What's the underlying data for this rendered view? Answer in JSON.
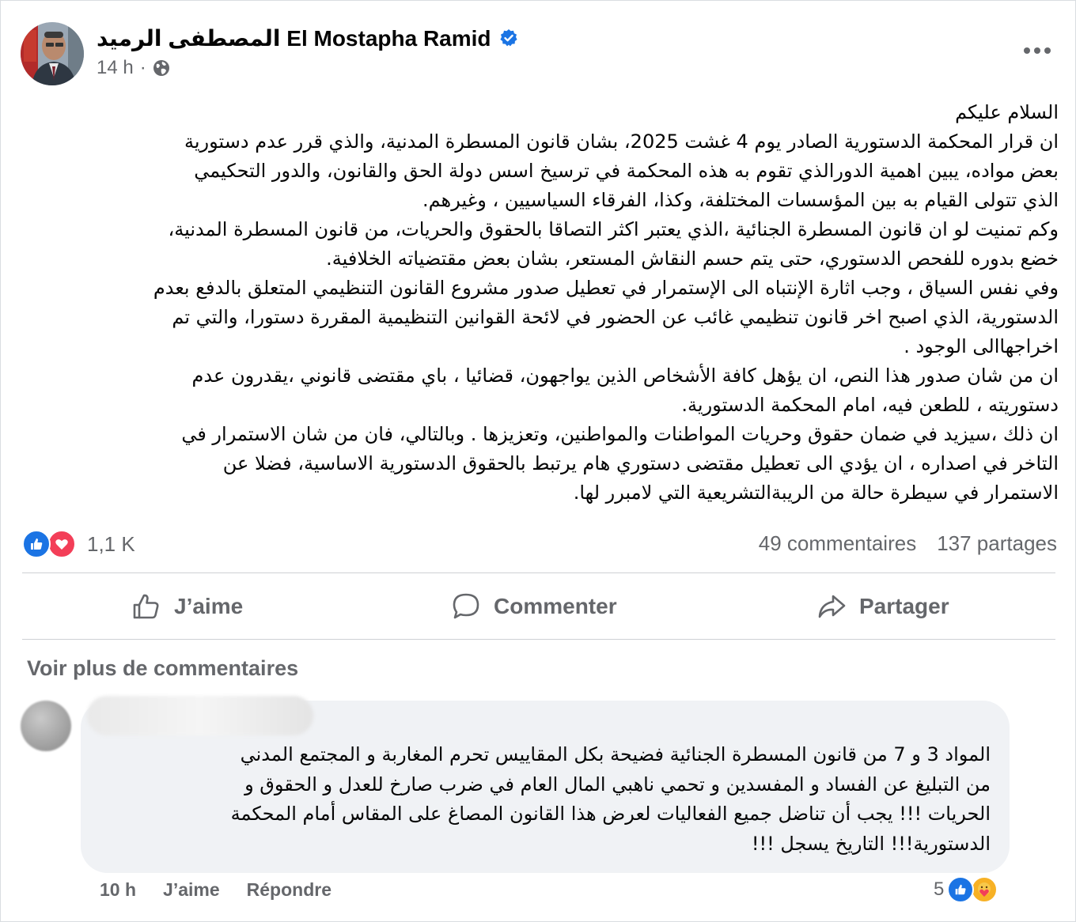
{
  "post": {
    "author": "المصطفى الرميد El Mostapha Ramid",
    "time": "14 h",
    "separator": "·",
    "body_lines": [
      "السلام عليكم",
      "ان قرار المحكمة الدستورية الصادر يوم 4 غشت 2025، بشان قانون المسطرة المدنية، والذي قرر عدم دستورية",
      "بعض مواده، يبين اهمية الدورالذي تقوم به هذه المحكمة في ترسيخ اسس دولة الحق والقانون، والدور التحكيمي",
      "الذي تتولى القيام به بين المؤسسات المختلفة، وكذا، الفرقاء السياسيين ، وغيرهم.",
      "وكم تمنيت  لو ان قانون المسطرة الجنائية ،الذي يعتبر اكثر التصاقا بالحقوق والحريات، من قانون المسطرة المدنية،",
      "خضع بدوره للفحص الدستوري، حتى يتم حسم النقاش المستعر، بشان بعض مقتضياته الخلافية.",
      "وفي نفس السياق  ،  وجب اثارة الإنتباه الى الإستمرار في تعطيل صدور مشروع القانون التنظيمي المتعلق بالدفع بعدم",
      "الدستورية، الذي اصبح اخر قانون تنظيمي غائب عن الحضور في لائحة القوانين التنظيمية المقررة دستورا، والتي تم",
      "اخراجهاالى الوجود .",
      "ان من شان صدور هذا النص، ان يؤهل كافة الأشخاص الذين يواجهون، قضائيا ، باي مقتضى قانوني ،يقدرون عدم",
      "دستوريته ،  للطعن فيه، امام المحكمة الدستورية.",
      " ان ذلك ،سيزيد في ضمان حقوق وحريات المواطنات والمواطنين، وتعزيزها . وبالتالي، فان من شان الاستمرار  في",
      "التاخر في اصداره  ،  ان يؤدي الى تعطيل مقتضى دستوري هام يرتبط  بالحقوق الدستورية الاساسية، فضلا عن",
      "الاستمرار في سيطرة حالة من الريبةالتشريعية التي لامبرر لها."
    ]
  },
  "stats": {
    "reactions_count": "1,1 K",
    "comments": "49 commentaires",
    "shares": "137 partages"
  },
  "actions": {
    "like": "J’aime",
    "comment": "Commenter",
    "share": "Partager"
  },
  "comments_section": {
    "more_label": "Voir plus de commentaires",
    "comment": {
      "lines": [
        "المواد 3 و 7 من قانون المسطرة الجنائية فضيحة بكل المقاييس تحرم المغاربة و المجتمع المدني",
        "من التبليغ عن الفساد و المفسدين و تحمي ناهبي المال العام في ضرب صارخ للعدل و الحقوق و",
        "الحريات !!! يجب أن تناضل جميع الفعاليات لعرض هذا القانون المصاغ على المقاس أمام المحكمة",
        "الدستورية!!! التاريخ يسجل !!!"
      ],
      "time": "10 h",
      "like_label": "J’aime",
      "reply_label": "Répondre",
      "reaction_count": "5"
    }
  },
  "colors": {
    "accent": "#1b74e4",
    "love": "#f33e58",
    "secondary_text": "#65676b",
    "comment_bg": "#f0f2f5"
  },
  "icons": [
    "verified-badge-icon",
    "globe-icon",
    "more-options-icon",
    "like-reaction-icon",
    "love-reaction-icon",
    "thumbs-up-icon",
    "comment-icon",
    "share-arrow-icon",
    "care-reaction-icon"
  ]
}
